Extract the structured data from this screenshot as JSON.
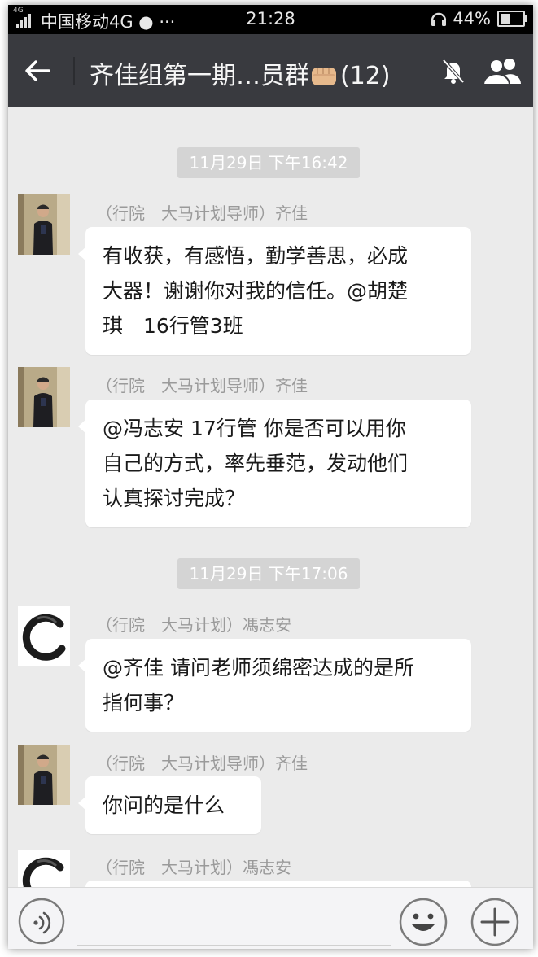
{
  "status_bar": {
    "network_badge": "4G",
    "carrier": "中国移动4G ●",
    "extra": "···",
    "time": "21:28",
    "battery": "44%",
    "battery_level": 0.44
  },
  "header": {
    "title": "齐佳组第一期…员群",
    "member_count": "(12)",
    "icons": [
      "back-arrow-icon",
      "mute-bell-icon",
      "group-members-icon"
    ]
  },
  "colors": {
    "navbar": "#393a3f",
    "chat_bg": "#ebebeb",
    "bubble": "#ffffff",
    "time_badge": "#d4d4d4"
  },
  "messages": [
    {
      "type": "time",
      "text": "11月29日 下午16:42"
    },
    {
      "type": "message",
      "avatar": "photo",
      "sender": "（行院　大马计划导师）齐佳",
      "lines": [
        "有收获，有感悟，勤学善思，必成",
        "大器！谢谢你对我的信任。@胡楚",
        "琪　16行管3班"
      ]
    },
    {
      "type": "message",
      "avatar": "photo",
      "sender": "（行院　大马计划导师）齐佳",
      "lines": [
        "@冯志安 17行管 你是否可以用你",
        "自己的方式，率先垂范，发动他们",
        "认真探讨完成？"
      ]
    },
    {
      "type": "time",
      "text": "11月29日 下午17:06"
    },
    {
      "type": "message",
      "avatar": "brush",
      "sender": "（行院　大马计划）馮志安",
      "lines": [
        "@齐佳 请问老师须绵密达成的是所",
        "指何事？"
      ]
    },
    {
      "type": "message",
      "avatar": "photo",
      "sender": "（行院　大马计划导师）齐佳",
      "lines": [
        "你问的是什么"
      ]
    },
    {
      "type": "message",
      "avatar": "brush",
      "sender": "（行院　大马计划）馮志安",
      "lines": []
    }
  ],
  "input_bar": {
    "icons": [
      "voice-icon",
      "emoji-icon",
      "plus-icon"
    ]
  }
}
